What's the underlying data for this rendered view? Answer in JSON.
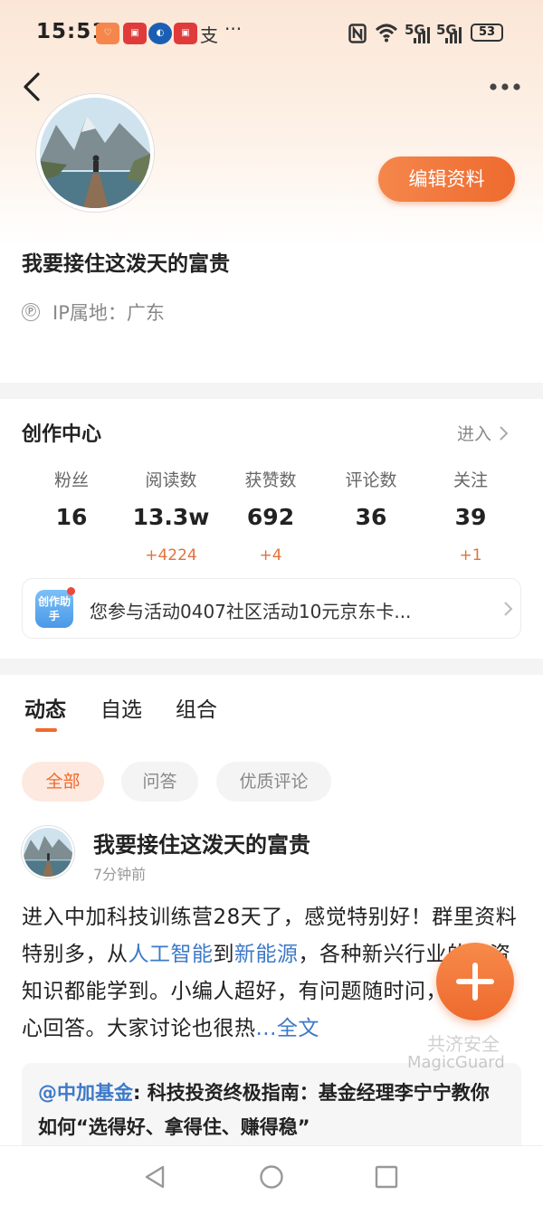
{
  "status_bar": {
    "time": "15:51",
    "apps": [
      "",
      "",
      "",
      "",
      "支",
      "···"
    ],
    "signal_1": "5G",
    "signal_2": "5G",
    "battery": "53"
  },
  "profile": {
    "username": "我要接住这泼天的富贵",
    "edit_button": "编辑资料",
    "ip_location": "IP属地：广东",
    "ip_icon": "Ⓟ"
  },
  "creation_center": {
    "title": "创作中心",
    "enter_label": "进入",
    "stats": [
      {
        "label": "粉丝",
        "value": "16",
        "delta": ""
      },
      {
        "label": "阅读数",
        "value": "13.3w",
        "delta": "+4224"
      },
      {
        "label": "获赞数",
        "value": "692",
        "delta": "+4"
      },
      {
        "label": "评论数",
        "value": "36",
        "delta": ""
      },
      {
        "label": "关注",
        "value": "39",
        "delta": "+1"
      }
    ],
    "activity": {
      "icon_text": "创作助手",
      "text": "您参与活动0407社区活动10元京东卡..."
    }
  },
  "tabs": [
    "动态",
    "自选",
    "组合"
  ],
  "filters": [
    "全部",
    "问答",
    "优质评论"
  ],
  "post": {
    "author": "我要接住这泼天的富贵",
    "time": "7分钟前",
    "body_1": "进入中加科技训练营28天了，感觉特别好！群里资料特别多，从",
    "link_1": "人工智能",
    "body_2": "到",
    "link_2": "新能源",
    "body_3": "，各种新兴行业的投资知识都能学到。小编人超好，有问题随时问，都会耐心回答。大家讨论也很热",
    "more": "...全文",
    "quote_mention": "@中加基金",
    "quote_text": ": 科技投资终极指南：基金经理李宁宁教你如何“选得好、拿得住、赚得稳”"
  },
  "watermark": {
    "line1": "共济安全",
    "line2": "MagicGuard"
  },
  "colors": {
    "accent": "#ee6a2e",
    "link": "#3d79c9"
  }
}
